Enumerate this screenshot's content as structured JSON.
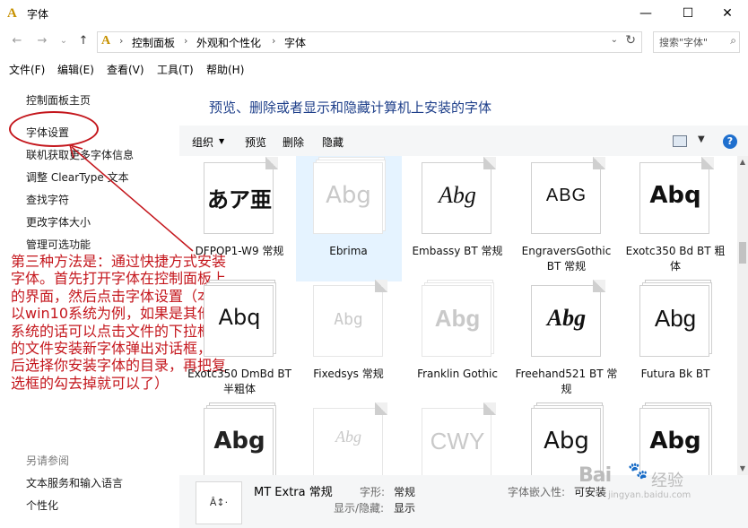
{
  "window": {
    "title": "字体",
    "controls": {
      "minimize": "—",
      "maximize": "☐",
      "close": "✕"
    }
  },
  "navigation": {
    "back": "←",
    "forward": "→",
    "recent": "⌄",
    "up": "↑",
    "breadcrumb": [
      "控制面板",
      "外观和个性化",
      "字体"
    ],
    "breadcrumb_sep": "›",
    "search_placeholder": "搜索\"字体\""
  },
  "menu": [
    "文件(F)",
    "编辑(E)",
    "查看(V)",
    "工具(T)",
    "帮助(H)"
  ],
  "left_pane": {
    "links": [
      "控制面板主页",
      "字体设置",
      "联机获取更多字体信息",
      "调整 ClearType 文本",
      "查找字符",
      "更改字体大小",
      "管理可选功能"
    ],
    "see_also_title": "另请参阅",
    "see_also": [
      "文本服务和输入语言",
      "个性化"
    ]
  },
  "annotation": {
    "text": "第三种方法是：通过快捷方式安装字体。首先打开字体在控制面板上的界面，然后点击字体设置（本例以win10系统为例，如果是其他系统的话可以点击文件的下拉框里的文件安装新字体弹出对话框，然后选择你安装字体的目录，再把复选框的勾去掉就可以了）",
    "color": "#c4161c"
  },
  "main": {
    "heading": "预览、删除或者显示和隐藏计算机上安装的字体",
    "toolbar": {
      "organize": "组织",
      "organize_arrow": "▼",
      "preview": "预览",
      "delete": "删除",
      "hide": "隐藏",
      "view_arrow": "▼",
      "help": "?"
    },
    "fonts": [
      {
        "name": "DFPOP1-W9 常规",
        "sample": "あア亜",
        "stack": false,
        "style": "dark"
      },
      {
        "name": "Ebrima",
        "sample": "Abg",
        "stack": true,
        "style": "light",
        "selected": true
      },
      {
        "name": "Embassy BT 常规",
        "sample": "Abg",
        "stack": false,
        "style": "dark"
      },
      {
        "name": "EngraversGothic BT 常规",
        "sample": "ABG",
        "stack": false,
        "style": "dark"
      },
      {
        "name": "Exotc350 Bd BT 粗体",
        "sample": "Abq",
        "stack": false,
        "style": "dark"
      },
      {
        "name": "Exotc350 DmBd BT 半粗体",
        "sample": "Abq",
        "stack": true,
        "style": "dark"
      },
      {
        "name": "Fixedsys 常规",
        "sample": "Abg",
        "stack": false,
        "style": "light"
      },
      {
        "name": "Franklin Gothic",
        "sample": "Abg",
        "stack": true,
        "style": "light"
      },
      {
        "name": "Freehand521 BT 常规",
        "sample": "Abg",
        "stack": false,
        "style": "dark"
      },
      {
        "name": "Futura Bk BT",
        "sample": "Abg",
        "stack": true,
        "style": "dark"
      },
      {
        "name": "",
        "sample": "Abg",
        "stack": true,
        "style": "dark"
      },
      {
        "name": "",
        "sample": "Abg",
        "stack": false,
        "style": "light"
      },
      {
        "name": "",
        "sample": "CWY",
        "stack": false,
        "style": "light"
      },
      {
        "name": "",
        "sample": "Abg",
        "stack": true,
        "style": "dark"
      },
      {
        "name": "",
        "sample": "Abg",
        "stack": true,
        "style": "dark"
      }
    ]
  },
  "details": {
    "icon_label": "Â↕·",
    "font_name": "MT Extra 常规",
    "shape_key": "字形:",
    "shape_val": "常规",
    "visibility_key": "显示/隐藏:",
    "visibility_val": "显示",
    "embed_key": "字体嵌入性:",
    "embed_val": "可安装"
  },
  "watermark": {
    "brand": "Bai",
    "paw": "🐾",
    "cn": "经验",
    "url": "jingyan.baidu.com"
  }
}
